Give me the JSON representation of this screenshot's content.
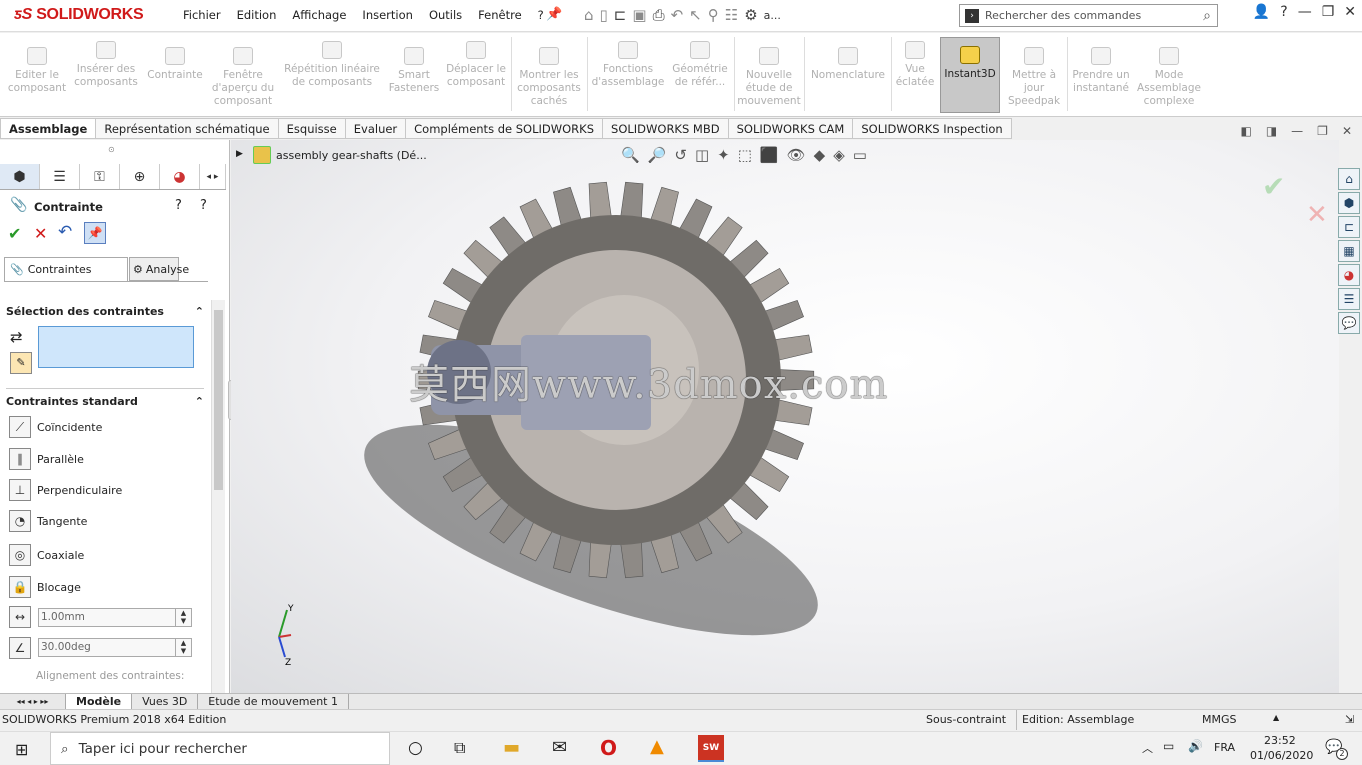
{
  "app": {
    "logo": "SOLIDWORKS"
  },
  "menu": [
    "Fichier",
    "Edition",
    "Affichage",
    "Insertion",
    "Outils",
    "Fenêtre",
    "?"
  ],
  "search": {
    "placeholder": "Rechercher des commandes",
    "more": "a..."
  },
  "ribbon": [
    {
      "label": "Editer le composant"
    },
    {
      "label": "Insérer des composants"
    },
    {
      "label": "Contrainte"
    },
    {
      "label": "Fenêtre d'aperçu du composant"
    },
    {
      "label": "Répétition linéaire de composants"
    },
    {
      "label": "Smart Fasteners"
    },
    {
      "label": "Déplacer le composant"
    },
    {
      "label": "Montrer les composants cachés"
    },
    {
      "label": "Fonctions d'assemblage"
    },
    {
      "label": "Géométrie de référ..."
    },
    {
      "label": "Nouvelle étude de mouvement"
    },
    {
      "label": "Nomenclature"
    },
    {
      "label": "Vue éclatée"
    },
    {
      "label": "Instant3D"
    },
    {
      "label": "Mettre à jour Speedpak"
    },
    {
      "label": "Prendre un instantané"
    },
    {
      "label": "Mode Assemblage complexe"
    }
  ],
  "tabs": [
    "Assemblage",
    "Représentation schématique",
    "Esquisse",
    "Evaluer",
    "Compléments de SOLIDWORKS",
    "SOLIDWORKS MBD",
    "SOLIDWORKS CAM",
    "SOLIDWORKS Inspection"
  ],
  "panel": {
    "title": "Contrainte",
    "subtabs": [
      "Contraintes",
      "Analyse"
    ],
    "section1": "Sélection des contraintes",
    "section2": "Contraintes standard",
    "mates": [
      "Coïncidente",
      "Parallèle",
      "Perpendiculaire",
      "Tangente",
      "Coaxiale",
      "Blocage"
    ],
    "distance": "1.00mm",
    "angle": "30.00deg",
    "align": "Alignement des contraintes:"
  },
  "tree": {
    "root": "assembly gear-shafts  (Dé..."
  },
  "watermark": "莫西网www.3dmox.com",
  "bottomtabs": [
    "Modèle",
    "Vues 3D",
    "Etude de mouvement 1"
  ],
  "status": {
    "edition": "SOLIDWORKS Premium 2018 x64 Edition",
    "sous": "Sous-contraint",
    "editing": "Edition: Assemblage",
    "units": "MMGS"
  },
  "taskbar": {
    "search": "Taper ici pour rechercher",
    "lang": "FRA",
    "time": "23:52",
    "date": "01/06/2020",
    "notif": "2"
  },
  "colors": {
    "accent": "#d01a1a",
    "gear": "#8e8a86",
    "shaft": "#8f94a8"
  }
}
